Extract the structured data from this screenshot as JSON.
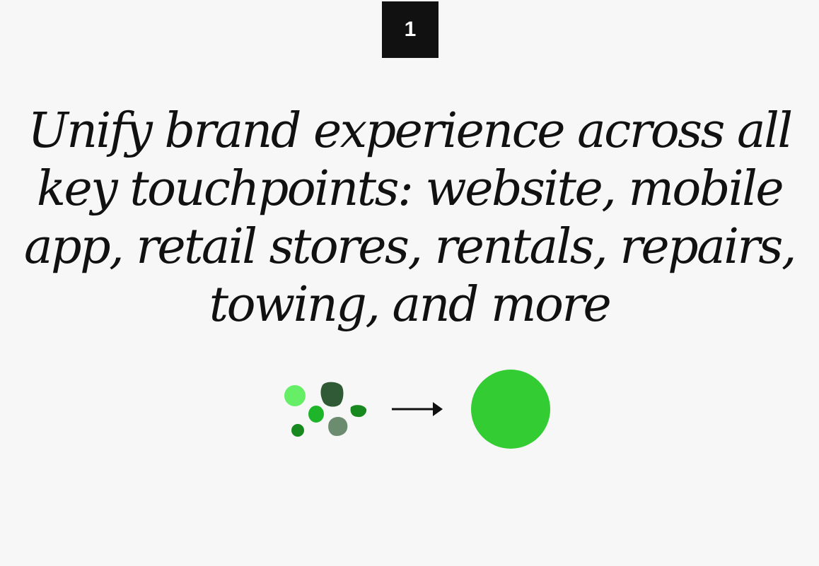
{
  "step": {
    "number": "1"
  },
  "headline": {
    "text": "Unify brand experience across all key touchpoints: website, mobile app, retail stores, rentals, repairs, towing, and more"
  },
  "illustration": {
    "icons": [
      "scattered-blobs-icon",
      "arrow-right-icon",
      "unified-circle-icon"
    ],
    "colors": {
      "blob_light": "#66ee66",
      "blob_dark": "#2f5a35",
      "blob_mid": "#1fb52a",
      "blob_deep": "#18891f",
      "blob_gray": "#6c8c70",
      "unified_circle": "#33cc33",
      "arrow": "#111111"
    }
  }
}
